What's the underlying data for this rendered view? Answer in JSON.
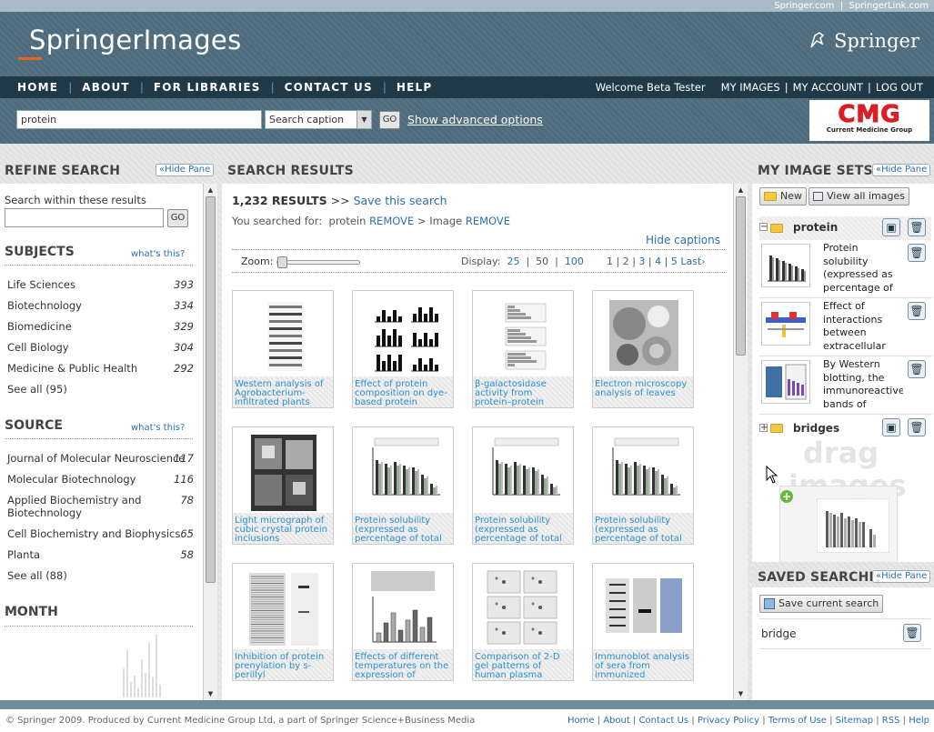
{
  "top_links": [
    "Springer.com",
    "SpringerLink.com"
  ],
  "brand": {
    "logo_text": "SpringerImages",
    "publisher": "Springer"
  },
  "nav": {
    "items": [
      "HOME",
      "ABOUT",
      "FOR LIBRARIES",
      "CONTACT US",
      "HELP"
    ]
  },
  "user": {
    "welcome": "Welcome Beta Tester",
    "links": [
      "MY IMAGES",
      "MY ACCOUNT",
      "LOG OUT"
    ]
  },
  "search": {
    "value": "protein",
    "scope": "Search caption",
    "go": "GO",
    "advanced": "Show advanced options"
  },
  "sponsor": {
    "logo": "CMG",
    "name": "Current Medicine Group"
  },
  "refine": {
    "title": "REFINE SEARCH",
    "hide": "«Hide Pane",
    "within_label": "Search within these results",
    "go": "GO",
    "whats_this": "what's this?",
    "subjects_title": "SUBJECTS",
    "subjects": [
      {
        "label": "Life Sciences",
        "count": "393"
      },
      {
        "label": "Biotechnology",
        "count": "334"
      },
      {
        "label": "Biomedicine",
        "count": "329"
      },
      {
        "label": "Cell Biology",
        "count": "304"
      },
      {
        "label": "Medicine & Public Health",
        "count": "292"
      }
    ],
    "subjects_seeall": "See all (95)",
    "source_title": "SOURCE",
    "sources": [
      {
        "label": "Journal of Molecular Neuroscience",
        "count": "117"
      },
      {
        "label": "Molecular Biotechnology",
        "count": "116"
      },
      {
        "label": "Applied Biochemistry and Biotechnology",
        "count": "78"
      },
      {
        "label": "Cell Biochemistry and Biophysics",
        "count": "65"
      },
      {
        "label": "Planta",
        "count": "58"
      }
    ],
    "sources_seeall": "See all (88)",
    "month_title": "MONTH"
  },
  "results": {
    "title": "SEARCH RESULTS",
    "count": "1,232 RESULTS",
    "arrows": ">>",
    "save_search": "Save this search",
    "searched_for": "You searched for:",
    "term1": "protein",
    "remove": "REMOVE",
    "gt": ">",
    "term2": "Image",
    "hide_captions": "Hide captions",
    "zoom": "Zoom:",
    "display": "Display:",
    "display_opts": [
      "25",
      "50",
      "100"
    ],
    "pages": [
      "1",
      "2",
      "3",
      "4",
      "5"
    ],
    "last": "Last›",
    "items": [
      {
        "caption": "Western analysis of Agrobacterium-infiltrated plants",
        "kind": "blot"
      },
      {
        "caption": "Effect of protein composition on dye-based protein",
        "kind": "bars"
      },
      {
        "caption": "β-galactosidase activity from protein–protein",
        "kind": "hbars"
      },
      {
        "caption": "Electron microscopy analysis of leaves",
        "kind": "micro"
      },
      {
        "caption": "Light micrograph of cubic crystal protein inclusions",
        "kind": "crystal"
      },
      {
        "caption": "Protein solubility (expressed as percentage of total",
        "kind": "chart"
      },
      {
        "caption": "Protein solubility (expressed as percentage of total",
        "kind": "chart"
      },
      {
        "caption": "Protein solubility (expressed as percentage of total",
        "kind": "chart"
      },
      {
        "caption": "Inhibition of protein prenylation by s-perillyl",
        "kind": "gel"
      },
      {
        "caption": "Effects of different temperatures on the expression of",
        "kind": "mixed"
      },
      {
        "caption": "Comparison of 2-D gel patterns of human plasma",
        "kind": "2d"
      },
      {
        "caption": "Immunoblot analysis of sera from immunized",
        "kind": "immuno"
      }
    ]
  },
  "sets": {
    "title": "MY IMAGE SETS",
    "hide": "«Hide Pane",
    "new": "New",
    "view_all": "View all images",
    "set1": "protein",
    "set1_items": [
      {
        "text": "Protein solubility (expressed as percentage of total protein) of"
      },
      {
        "text": "Effect of interactions between extracellular"
      },
      {
        "text": "By Western blotting, the immunoreactive bands of GAPDH"
      }
    ],
    "set2": "bridges",
    "drag": "drag images"
  },
  "saved": {
    "title": "SAVED SEARCHES",
    "hide": "«Hide Pane",
    "save_current": "Save current search",
    "items": [
      "bridge"
    ]
  },
  "footer": {
    "copyright": "© Springer 2009. Produced by Current Medicine Group Ltd, a part of Springer Science+Business Media",
    "links": [
      "Home",
      "About",
      "Contact Us",
      "Privacy Policy",
      "Terms of Use",
      "Sitemap",
      "RSS",
      "Help"
    ]
  }
}
